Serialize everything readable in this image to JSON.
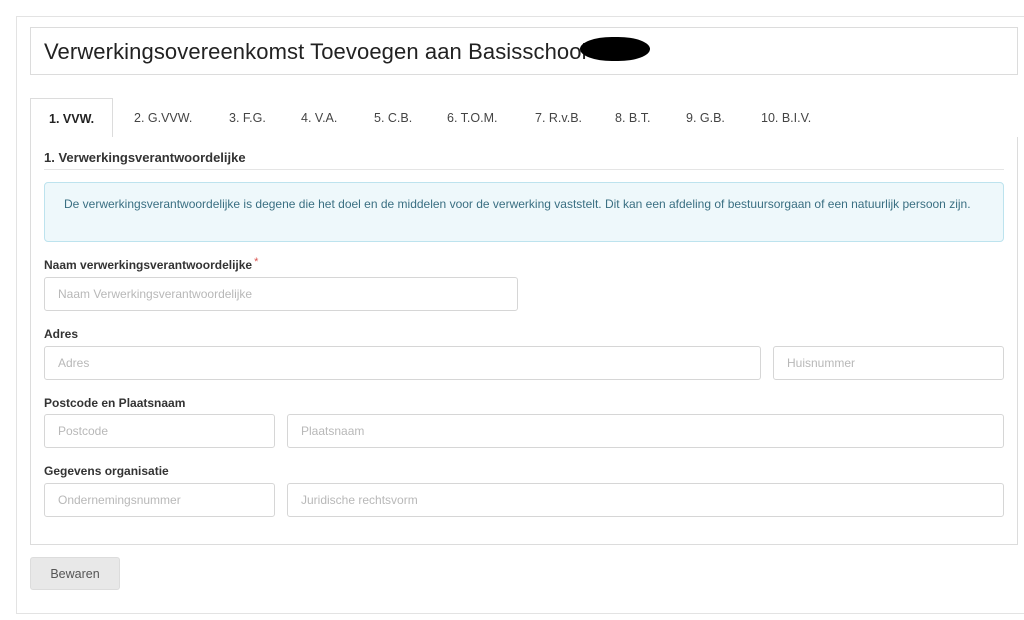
{
  "page": {
    "title": "Verwerkingsovereenkomst Toevoegen aan Basisschool"
  },
  "tabs": [
    {
      "label": "1. VVW."
    },
    {
      "label": "2. G.VVW."
    },
    {
      "label": "3. F.G."
    },
    {
      "label": "4. V.A."
    },
    {
      "label": "5. C.B."
    },
    {
      "label": "6. T.O.M."
    },
    {
      "label": "7. R.v.B."
    },
    {
      "label": "8. B.T."
    },
    {
      "label": "9. G.B."
    },
    {
      "label": "10. B.I.V."
    }
  ],
  "section": {
    "title": "1. Verwerkingsverantwoordelijke",
    "info": "De verwerkingsverantwoordelijke is degene die het doel en de middelen voor de verwerking vaststelt. Dit kan een afdeling of bestuursorgaan of een natuurlijk persoon zijn."
  },
  "fields": {
    "naam": {
      "label": "Naam verwerkingsverantwoordelijke",
      "required_mark": "*",
      "placeholder": "Naam Verwerkingsverantwoordelijke",
      "value": ""
    },
    "adres": {
      "label": "Adres",
      "adres_placeholder": "Adres",
      "huisnummer_placeholder": "Huisnummer"
    },
    "postcode_plaats": {
      "label": "Postcode en Plaatsnaam",
      "postcode_placeholder": "Postcode",
      "plaatsnaam_placeholder": "Plaatsnaam"
    },
    "organisatie": {
      "label": "Gegevens organisatie",
      "ondernemingsnummer_placeholder": "Ondernemingsnummer",
      "rechtsvorm_placeholder": "Juridische rechtsvorm"
    }
  },
  "actions": {
    "save_label": "Bewaren"
  }
}
